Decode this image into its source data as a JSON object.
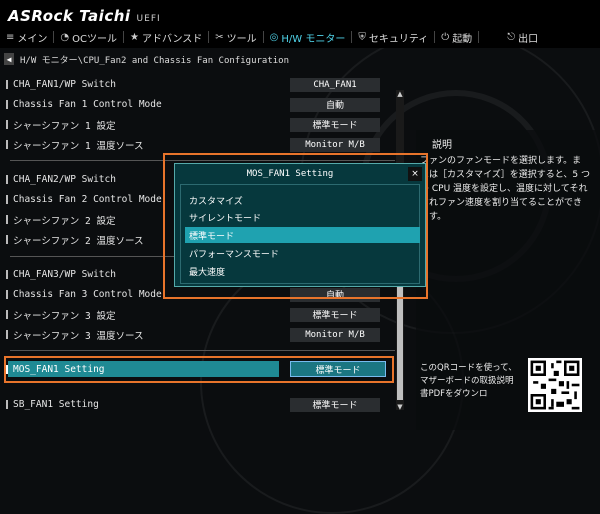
{
  "brand": {
    "name": "ASRock Taichi",
    "uefi": "UEFI"
  },
  "nav": [
    {
      "label": "メイン",
      "icon": "list-icon",
      "glyph": "≡"
    },
    {
      "label": "OCツール",
      "icon": "speedometer-icon",
      "glyph": "◔"
    },
    {
      "label": "アドバンスド",
      "icon": "star-icon",
      "glyph": "★"
    },
    {
      "label": "ツール",
      "icon": "tools-icon",
      "glyph": "✂"
    },
    {
      "label": "H/W モニター",
      "icon": "monitor-icon",
      "glyph": "◎"
    },
    {
      "label": "セキュリティ",
      "icon": "shield-icon",
      "glyph": "⛨"
    },
    {
      "label": "起動",
      "icon": "power-icon",
      "glyph": "⏻"
    },
    {
      "label": "出口",
      "icon": "exit-icon",
      "glyph": "⎋"
    }
  ],
  "breadcrumb": "H/W モニター\\CPU_Fan2 and Chassis Fan Configuration",
  "rows": [
    {
      "label": "CHA_FAN1/WP Switch",
      "value": "CHA_FAN1"
    },
    {
      "label": "Chassis Fan 1 Control Mode",
      "value": "自動"
    },
    {
      "label": "シャーシファン 1 設定",
      "value": "標準モード"
    },
    {
      "label": "シャーシファン 1 温度ソース",
      "value": "Monitor M/B"
    },
    {
      "label": "CHA_FAN2/WP Switch",
      "value": ""
    },
    {
      "label": "Chassis Fan 2 Control Mode",
      "value": ""
    },
    {
      "label": "シャーシファン 2 設定",
      "value": ""
    },
    {
      "label": "シャーシファン 2 温度ソース",
      "value": ""
    },
    {
      "label": "CHA_FAN3/WP Switch",
      "value": ""
    },
    {
      "label": "Chassis Fan 3 Control Mode",
      "value": "自動"
    },
    {
      "label": "シャーシファン 3 設定",
      "value": "標準モード"
    },
    {
      "label": "シャーシファン 3 温度ソース",
      "value": "Monitor M/B"
    },
    {
      "label": "SB_FAN1 Setting",
      "value": "標準モード"
    }
  ],
  "selected_row": {
    "label": "MOS_FAN1 Setting",
    "value": "標準モード"
  },
  "info": {
    "title": "説明",
    "text": "ファンのファンモードを選択します。または［カスタマイズ］を選択すると、5 つの CPU 温度を設定し、温度に対してそれぞれファン速度を割り当てることができます。",
    "qr_text": "このQRコードを使って、マザーボードの取扱説明書PDFをダウンロ"
  },
  "modal": {
    "title": "MOS_FAN1 Setting",
    "close": "×",
    "options": [
      "カスタマイズ",
      "サイレントモード",
      "標準モード",
      "パフォーマンスモード",
      "最大速度"
    ],
    "selected_index": 2
  },
  "colors": {
    "accent": "#4fd2e8",
    "highlight": "#e8742b",
    "selection": "#1fa2b0"
  }
}
